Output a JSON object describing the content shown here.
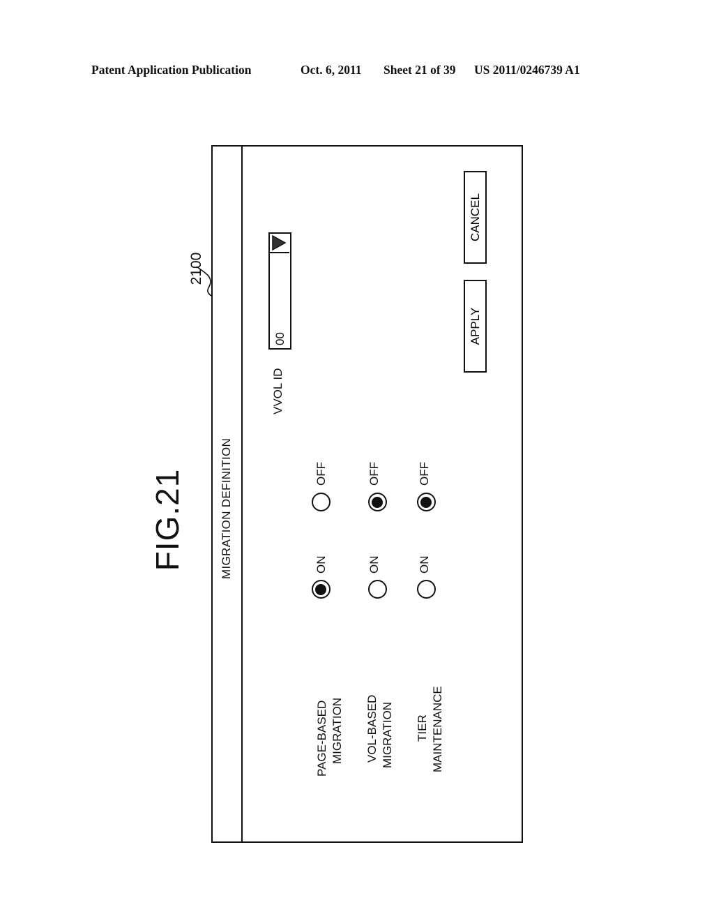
{
  "header": {
    "publication": "Patent Application Publication",
    "date": "Oct. 6, 2011",
    "sheet": "Sheet 21 of 39",
    "patent_number": "US 2011/0246739 A1"
  },
  "figure": {
    "label": "FIG.21",
    "reference_number": "2100"
  },
  "dialog": {
    "title": "MIGRATION DEFINITION",
    "option_on_label": "ON",
    "option_off_label": "OFF",
    "rows": [
      {
        "label_line1": "PAGE-BASED",
        "label_line2": "MIGRATION",
        "selected": "ON"
      },
      {
        "label_line1": "VOL-BASED",
        "label_line2": "MIGRATION",
        "selected": "OFF"
      },
      {
        "label_line1": "TIER",
        "label_line2": "MAINTENANCE",
        "selected": "OFF"
      }
    ],
    "vvol": {
      "label": "VVOL ID",
      "value": "00",
      "dropdown_icon": "triangle-down-icon"
    },
    "buttons": {
      "apply": "APPLY",
      "cancel": "CANCEL"
    }
  }
}
